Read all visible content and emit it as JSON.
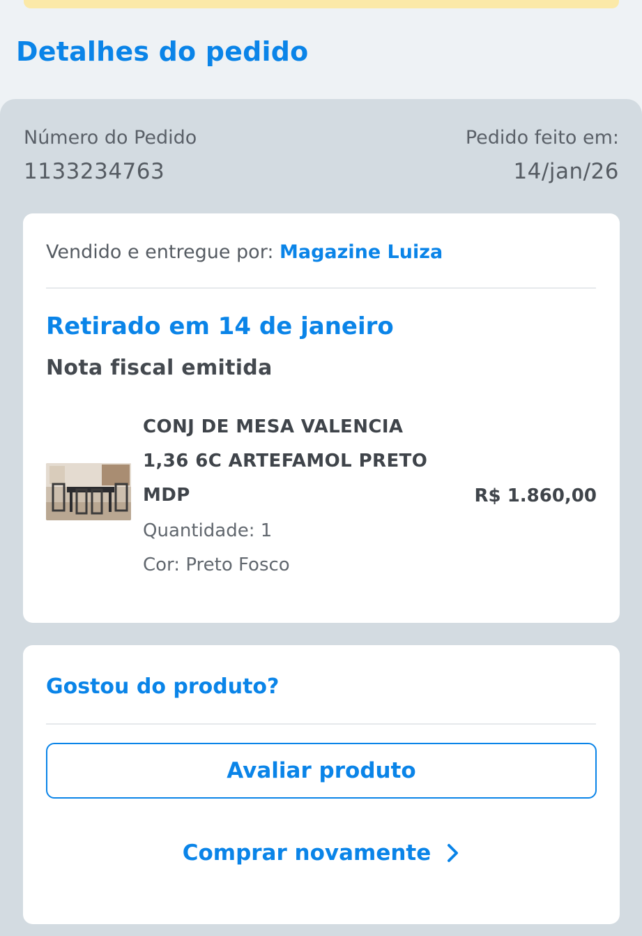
{
  "header": {
    "title": "Detalhes do pedido"
  },
  "order": {
    "number_label": "Número do Pedido",
    "number_value": "1133234763",
    "date_label": "Pedido feito em:",
    "date_value": "14/jan/26"
  },
  "shipment": {
    "seller_prefix": "Vendido e entregue por: ",
    "seller_name": "Magazine Luiza",
    "status_title": "Retirado em 14 de janeiro",
    "status_subtitle": "Nota fiscal emitida"
  },
  "product": {
    "name_line1": "CONJ DE MESA VALENCIA",
    "name_line2": "1,36 6C ARTEFAMOL PRETO",
    "name_line3": "MDP",
    "quantity": "Quantidade: 1",
    "color": "Cor: Preto Fosco",
    "price": "R$ 1.860,00",
    "image_icon": "dining-table-photo"
  },
  "review": {
    "title": "Gostou do produto?",
    "button_label": "Avaliar produto",
    "buy_again_label": "Comprar novamente",
    "buy_again_icon": "chevron-right-icon"
  },
  "colors": {
    "accent": "#0a84e8",
    "panel_bg": "#d3dbe1",
    "page_bg": "#eef2f5",
    "banner": "#fbe9a8"
  }
}
